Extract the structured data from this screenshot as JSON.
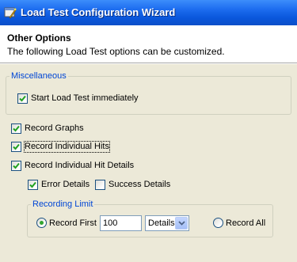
{
  "window": {
    "title": "Load Test Configuration Wizard",
    "icon": "wizard-icon"
  },
  "header": {
    "heading": "Other Options",
    "subheading": "The following Load Test options can be customized."
  },
  "misc_group": {
    "legend": "Miscellaneous",
    "start_immediately": {
      "label": "Start Load Test immediately",
      "checked": true
    }
  },
  "options": {
    "record_graphs": {
      "label": "Record Graphs",
      "checked": true
    },
    "record_individual_hits": {
      "label": "Record Individual Hits",
      "checked": true
    },
    "record_individual_hit_details": {
      "label": "Record Individual Hit Details",
      "checked": true
    },
    "error_details": {
      "label": "Error Details",
      "checked": true
    },
    "success_details": {
      "label": "Success Details",
      "checked": false
    }
  },
  "recording_limit": {
    "legend": "Recording Limit",
    "record_first": {
      "label": "Record First",
      "selected": true,
      "count": "100",
      "unit": "Details"
    },
    "record_all": {
      "label": "Record All",
      "selected": false
    }
  },
  "colors": {
    "titlebar": "#0a57dc",
    "groupbox_legend": "#0046d5",
    "dialog_bg": "#ece9d8",
    "check": "#21a121"
  }
}
